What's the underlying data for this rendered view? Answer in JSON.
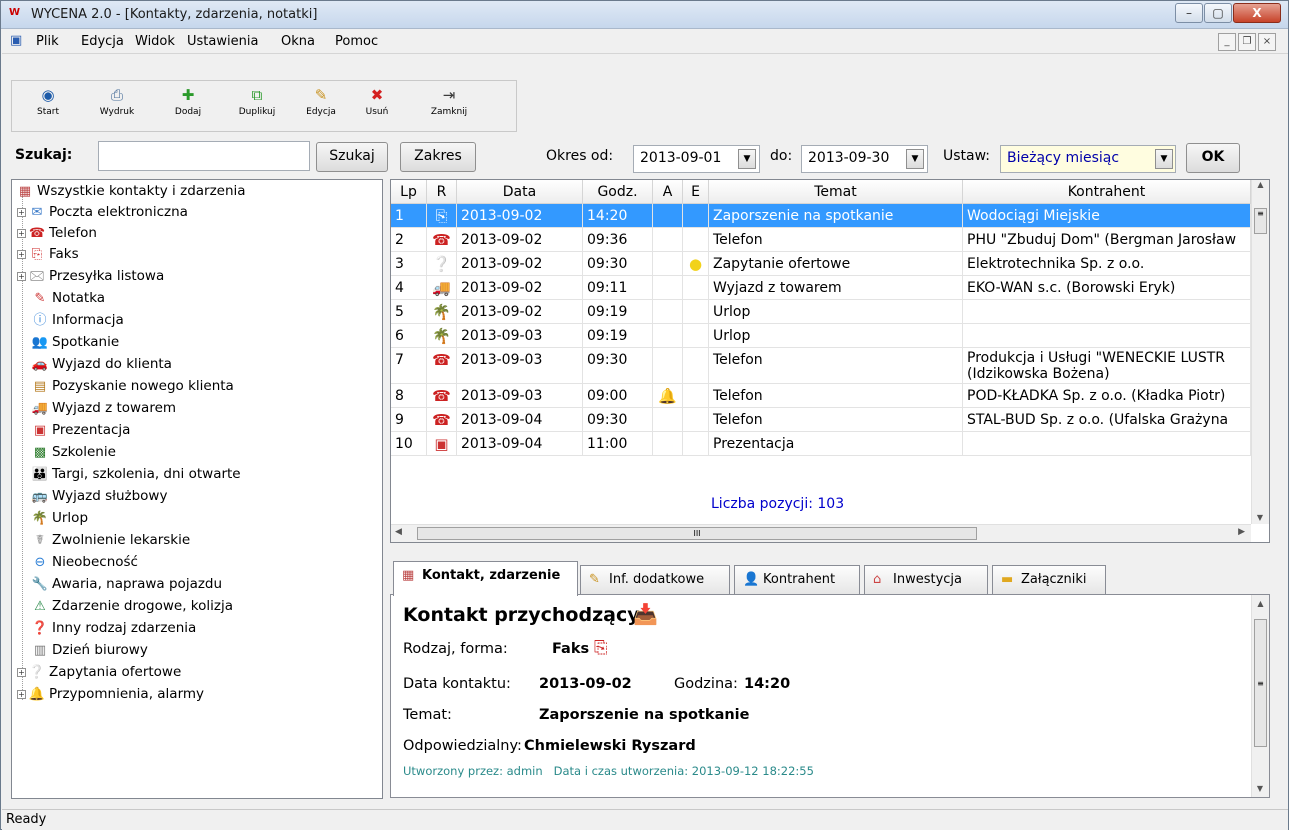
{
  "window": {
    "title": "WYCENA 2.0 - [Kontakty, zdarzenia, notatki]"
  },
  "menu": [
    "Plik",
    "Edycja",
    "Widok",
    "Ustawienia",
    "Okna",
    "Pomoc"
  ],
  "toolbar": [
    {
      "label": "Start",
      "icon": "start-icon"
    },
    {
      "label": "Wydruk",
      "icon": "printer-icon"
    },
    {
      "label": "Dodaj",
      "icon": "add-icon"
    },
    {
      "label": "Duplikuj",
      "icon": "duplicate-icon"
    },
    {
      "label": "Edycja",
      "icon": "edit-icon"
    },
    {
      "label": "Usuń",
      "icon": "delete-icon"
    },
    {
      "label": "Zamknij",
      "icon": "exit-icon"
    }
  ],
  "search": {
    "label": "Szukaj:",
    "value": "",
    "button": "Szukaj",
    "range_button": "Zakres",
    "from_label": "Okres od:",
    "from": "2013-09-01",
    "to_label": "do:",
    "to": "2013-09-30",
    "set_label": "Ustaw:",
    "set_value": "Bieżący miesiąc",
    "ok": "OK"
  },
  "tree": [
    {
      "label": "Wszystkie kontakty i zdarzenia",
      "icon": "calendar-icon"
    },
    {
      "label": "Poczta elektroniczna",
      "icon": "email-icon",
      "expandable": true
    },
    {
      "label": "Telefon",
      "icon": "phone-icon",
      "expandable": true
    },
    {
      "label": "Faks",
      "icon": "fax-icon",
      "expandable": true
    },
    {
      "label": "Przesyłka listowa",
      "icon": "letter-icon",
      "expandable": true
    },
    {
      "label": "Notatka",
      "icon": "note-icon"
    },
    {
      "label": "Informacja",
      "icon": "info-icon"
    },
    {
      "label": "Spotkanie",
      "icon": "meeting-icon"
    },
    {
      "label": "Wyjazd do klienta",
      "icon": "car-icon"
    },
    {
      "label": "Pozyskanie nowego klienta",
      "icon": "new-client-icon"
    },
    {
      "label": "Wyjazd z towarem",
      "icon": "truck-icon"
    },
    {
      "label": "Prezentacja",
      "icon": "presentation-icon"
    },
    {
      "label": "Szkolenie",
      "icon": "training-icon"
    },
    {
      "label": "Targi, szkolenia, dni otwarte",
      "icon": "fair-icon"
    },
    {
      "label": "Wyjazd służbowy",
      "icon": "bus-icon"
    },
    {
      "label": "Urlop",
      "icon": "palm-icon"
    },
    {
      "label": "Zwolnienie lekarskie",
      "icon": "doctor-icon"
    },
    {
      "label": "Nieobecność",
      "icon": "absence-icon"
    },
    {
      "label": "Awaria, naprawa pojazdu",
      "icon": "repair-icon"
    },
    {
      "label": "Zdarzenie drogowe, kolizja",
      "icon": "collision-icon"
    },
    {
      "label": "Inny rodzaj zdarzenia",
      "icon": "other-icon"
    },
    {
      "label": "Dzień biurowy",
      "icon": "office-icon"
    },
    {
      "label": "Zapytania ofertowe",
      "icon": "inquiry-icon",
      "expandable": true
    },
    {
      "label": "Przypomnienia, alarmy",
      "icon": "bell-icon",
      "expandable": true
    }
  ],
  "grid": {
    "columns": [
      "Lp",
      "R",
      "Data",
      "Godz.",
      "A",
      "E",
      "Temat",
      "Kontrahent"
    ],
    "rows": [
      {
        "lp": "1",
        "icon": "fax-icon",
        "date": "2013-09-02",
        "time": "14:20",
        "a": "",
        "e": "",
        "topic": "Zaporszenie na spotkanie",
        "client": "Wodociągi Miejskie",
        "selected": true
      },
      {
        "lp": "2",
        "icon": "phone-icon",
        "date": "2013-09-02",
        "time": "09:36",
        "a": "",
        "e": "",
        "topic": "Telefon",
        "client": "PHU \"Zbuduj Dom\" (Bergman Jarosław"
      },
      {
        "lp": "3",
        "icon": "inquiry-icon",
        "date": "2013-09-02",
        "time": "09:30",
        "a": "",
        "e": "yellow-circle-icon",
        "topic": "Zapytanie ofertowe",
        "client": "Elektrotechnika Sp. z o.o."
      },
      {
        "lp": "4",
        "icon": "truck-icon",
        "date": "2013-09-02",
        "time": "09:11",
        "a": "",
        "e": "",
        "topic": "Wyjazd z towarem",
        "client": "EKO-WAN s.c. (Borowski Eryk)"
      },
      {
        "lp": "5",
        "icon": "palm-icon",
        "date": "2013-09-02",
        "time": "09:19",
        "a": "",
        "e": "",
        "topic": "Urlop",
        "client": ""
      },
      {
        "lp": "6",
        "icon": "palm-icon",
        "date": "2013-09-03",
        "time": "09:19",
        "a": "",
        "e": "",
        "topic": "Urlop",
        "client": ""
      },
      {
        "lp": "7",
        "icon": "phone-icon",
        "date": "2013-09-03",
        "time": "09:30",
        "a": "",
        "e": "",
        "topic": "Telefon",
        "client": "Produkcja i Usługi \"WENECKIE LUSTR",
        "client2": "(Idzikowska Bożena)"
      },
      {
        "lp": "8",
        "icon": "phone-icon",
        "date": "2013-09-03",
        "time": "09:00",
        "a": "bell-alarm-icon",
        "e": "",
        "topic": "Telefon",
        "client": "POD-KŁADKA Sp. z o.o. (Kładka Piotr)"
      },
      {
        "lp": "9",
        "icon": "phone-icon",
        "date": "2013-09-04",
        "time": "09:30",
        "a": "",
        "e": "",
        "topic": "Telefon",
        "client": "STAL-BUD Sp. z o.o. (Ufalska Grażyna"
      },
      {
        "lp": "10",
        "icon": "presentation-icon",
        "date": "2013-09-04",
        "time": "11:00",
        "a": "",
        "e": "",
        "topic": "Prezentacja",
        "client": ""
      }
    ],
    "count": "Liczba pozycji: 103"
  },
  "tabs": [
    {
      "label": "Kontakt, zdarzenie",
      "icon": "calendar-icon",
      "active": true
    },
    {
      "label": "Inf. dodatkowe",
      "icon": "edit-icon"
    },
    {
      "label": "Kontrahent",
      "icon": "person-icon"
    },
    {
      "label": "Inwestycja",
      "icon": "house-icon"
    },
    {
      "label": "Załączniki",
      "icon": "folder-icon"
    }
  ],
  "detail": {
    "heading": "Kontakt przychodzący",
    "kind_label": "Rodzaj, forma:",
    "kind": "Faks",
    "date_label": "Data kontaktu:",
    "date": "2013-09-02",
    "time_label": "Godzina:",
    "time": "14:20",
    "topic_label": "Temat:",
    "topic": "Zaporszenie na spotkanie",
    "resp_label": "Odpowiedzialny:",
    "resp": "Chmielewski Ryszard",
    "created": "Utworzony przez: admin   Data i czas utworzenia: 2013-09-12 18:22:55"
  },
  "status": "Ready",
  "colors": {
    "selection": "#3399ff",
    "count": "#0000cc",
    "created": "#2a8a8a"
  }
}
